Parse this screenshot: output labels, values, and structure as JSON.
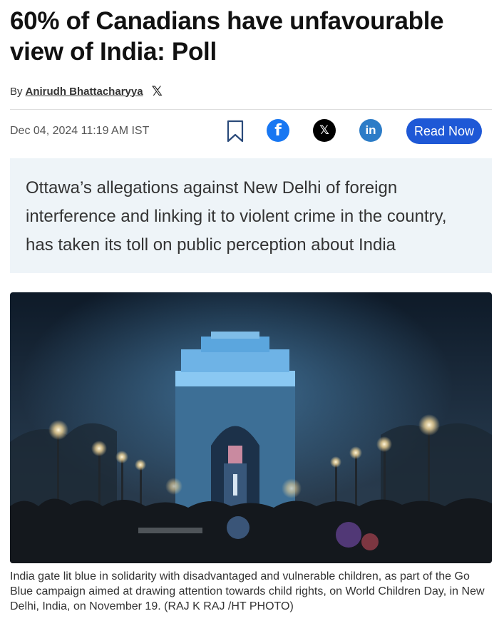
{
  "article": {
    "headline": "60% of Canadians have unfavourable view of India: Poll",
    "byline_prefix": "By",
    "author": "Anirudh Bhattacharyya",
    "author_social_icon": "x-icon",
    "date": "Dec 04, 2024 11:19 AM IST",
    "summary": "Ottawa’s allegations against New Delhi of foreign interference and linking it to violent crime in the country, has taken its toll on public perception about India",
    "caption": "India gate lit blue in solidarity with disadvantaged and vulnerable children, as part of the Go Blue campaign aimed at drawing attention towards child rights, on World Children Day, in New Delhi, India, on November 19. (RAJ K RAJ /HT PHOTO)"
  },
  "actions": {
    "bookmark_icon": "bookmark-icon",
    "facebook_label": "f",
    "x_label": "𝕏",
    "linkedin_label": "in",
    "read_now": "Read Now"
  },
  "colors": {
    "facebook": "#1877f2",
    "x": "#000000",
    "linkedin": "#2c7cc7",
    "read_now": "#1e58d6",
    "summary_bg": "#eef4f8"
  }
}
